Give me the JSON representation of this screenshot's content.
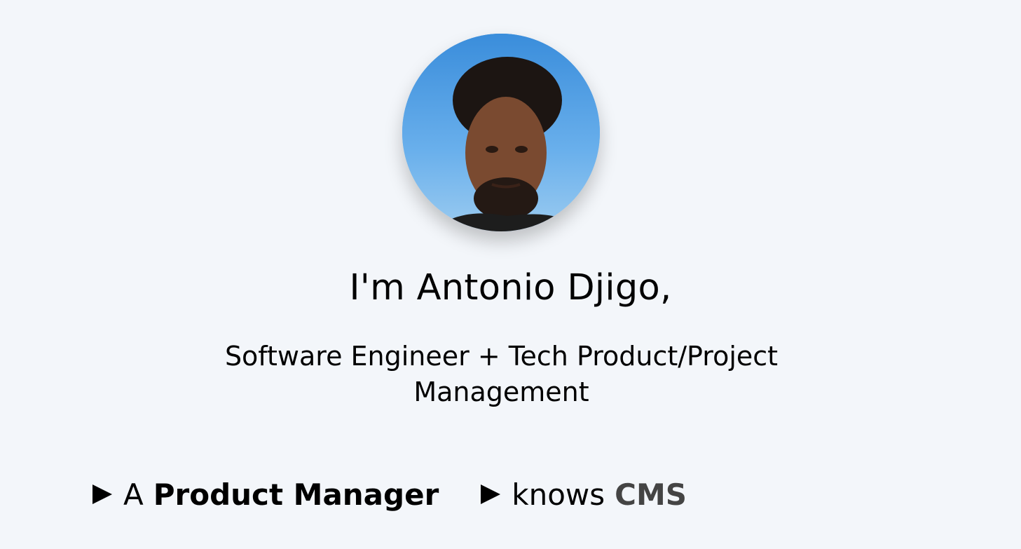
{
  "hero": {
    "avatar_alt": "Profile photo",
    "title": "I'm Antonio Djigo,",
    "subtitle": "Software Engineer + Tech Product/Project Management"
  },
  "traits": [
    {
      "prefix": "A",
      "highlight": "Product Manager",
      "icon": "play-triangle-icon"
    },
    {
      "prefix": "knows",
      "highlight": "CMS",
      "icon": "play-triangle-icon"
    }
  ],
  "colors": {
    "background": "#f3f6fa",
    "text": "#000000",
    "muted_highlight": "#444444"
  }
}
